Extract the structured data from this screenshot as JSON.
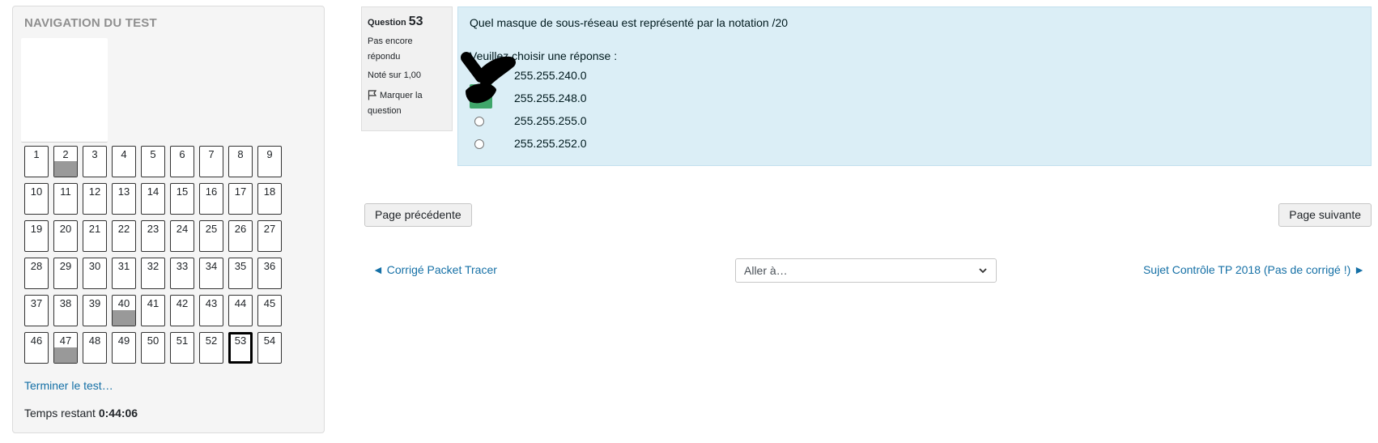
{
  "nav": {
    "title": "NAVIGATION DU TEST",
    "questions": [
      {
        "n": "1"
      },
      {
        "n": "2",
        "answered": true
      },
      {
        "n": "3"
      },
      {
        "n": "4"
      },
      {
        "n": "5"
      },
      {
        "n": "6"
      },
      {
        "n": "7"
      },
      {
        "n": "8"
      },
      {
        "n": "9"
      },
      {
        "n": "10"
      },
      {
        "n": "11"
      },
      {
        "n": "12"
      },
      {
        "n": "13"
      },
      {
        "n": "14"
      },
      {
        "n": "15"
      },
      {
        "n": "16"
      },
      {
        "n": "17"
      },
      {
        "n": "18"
      },
      {
        "n": "19"
      },
      {
        "n": "20"
      },
      {
        "n": "21"
      },
      {
        "n": "22"
      },
      {
        "n": "23"
      },
      {
        "n": "24"
      },
      {
        "n": "25"
      },
      {
        "n": "26"
      },
      {
        "n": "27"
      },
      {
        "n": "28"
      },
      {
        "n": "29"
      },
      {
        "n": "30"
      },
      {
        "n": "31"
      },
      {
        "n": "32"
      },
      {
        "n": "33"
      },
      {
        "n": "34"
      },
      {
        "n": "35"
      },
      {
        "n": "36"
      },
      {
        "n": "37"
      },
      {
        "n": "38"
      },
      {
        "n": "39"
      },
      {
        "n": "40",
        "answered": true
      },
      {
        "n": "41"
      },
      {
        "n": "42"
      },
      {
        "n": "43"
      },
      {
        "n": "44"
      },
      {
        "n": "45"
      },
      {
        "n": "46"
      },
      {
        "n": "47",
        "answered": true
      },
      {
        "n": "48"
      },
      {
        "n": "49"
      },
      {
        "n": "50"
      },
      {
        "n": "51"
      },
      {
        "n": "52"
      },
      {
        "n": "53",
        "current": true
      },
      {
        "n": "54"
      }
    ],
    "finish_link": "Terminer le test…",
    "time_label": "Temps restant",
    "time_value": "0:44:06"
  },
  "question_info": {
    "label": "Question",
    "number": "53",
    "state": "Pas encore répondu",
    "grade": "Noté sur 1,00",
    "flag_label": "Marquer la question"
  },
  "question": {
    "text": "Quel masque de sous-réseau est représenté par la notation /20",
    "prompt": "Veuillez choisir une réponse :",
    "answers": [
      "255.255.240.0",
      "255.255.248.0",
      "255.255.255.0",
      "255.255.252.0"
    ]
  },
  "buttons": {
    "prev_page": "Page précédente",
    "next_page": "Page suivante"
  },
  "activity_nav": {
    "prev": "◄ Corrigé Packet Tracer",
    "jump_placeholder": "Aller à…",
    "next": "Sujet Contrôle TP 2018 (Pas de corrigé !) ►"
  },
  "colors": {
    "link": "#1570a6",
    "question_bg": "#dbeef6",
    "answered_fill": "#999999",
    "highlight": "#3fa66a"
  }
}
